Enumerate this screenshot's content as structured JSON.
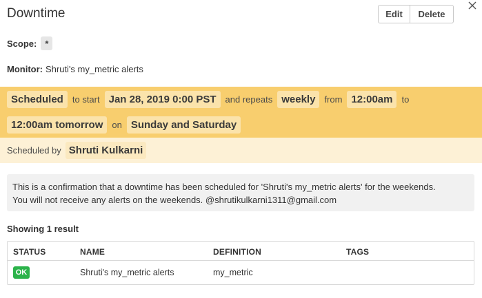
{
  "header": {
    "title": "Downtime",
    "edit_label": "Edit",
    "delete_label": "Delete",
    "close_icon": "close-icon"
  },
  "scope": {
    "label": "Scope:",
    "value": "*"
  },
  "monitor": {
    "label": "Monitor:",
    "value": "Shruti's my_metric alerts"
  },
  "schedule": {
    "status": "Scheduled",
    "to_start_text": "to start",
    "start_time": "Jan 28, 2019 0:00 PST",
    "repeats_text": "and repeats",
    "frequency": "weekly",
    "from_text": "from",
    "from_time": "12:00am",
    "to_text": "to",
    "to_time": "12:00am tomorrow",
    "on_text": "on",
    "days": "Sunday and Saturday",
    "accent_color": "#f8ce6e"
  },
  "scheduled_by": {
    "label": "Scheduled by",
    "name": "Shruti Kulkarni"
  },
  "message": {
    "line1": "This is a confirmation that a downtime has been scheduled for 'Shruti's my_metric alerts' for the weekends.",
    "line2": "You will not receive any alerts on the weekends. @shrutikulkarni1311@gmail.com"
  },
  "results": {
    "summary": "Showing 1 result",
    "columns": [
      "STATUS",
      "NAME",
      "DEFINITION",
      "TAGS"
    ],
    "rows": [
      {
        "status": "OK",
        "name": "Shruti's my_metric alerts",
        "definition": "my_metric",
        "tags": ""
      }
    ],
    "ok_color": "#2cb34a"
  }
}
